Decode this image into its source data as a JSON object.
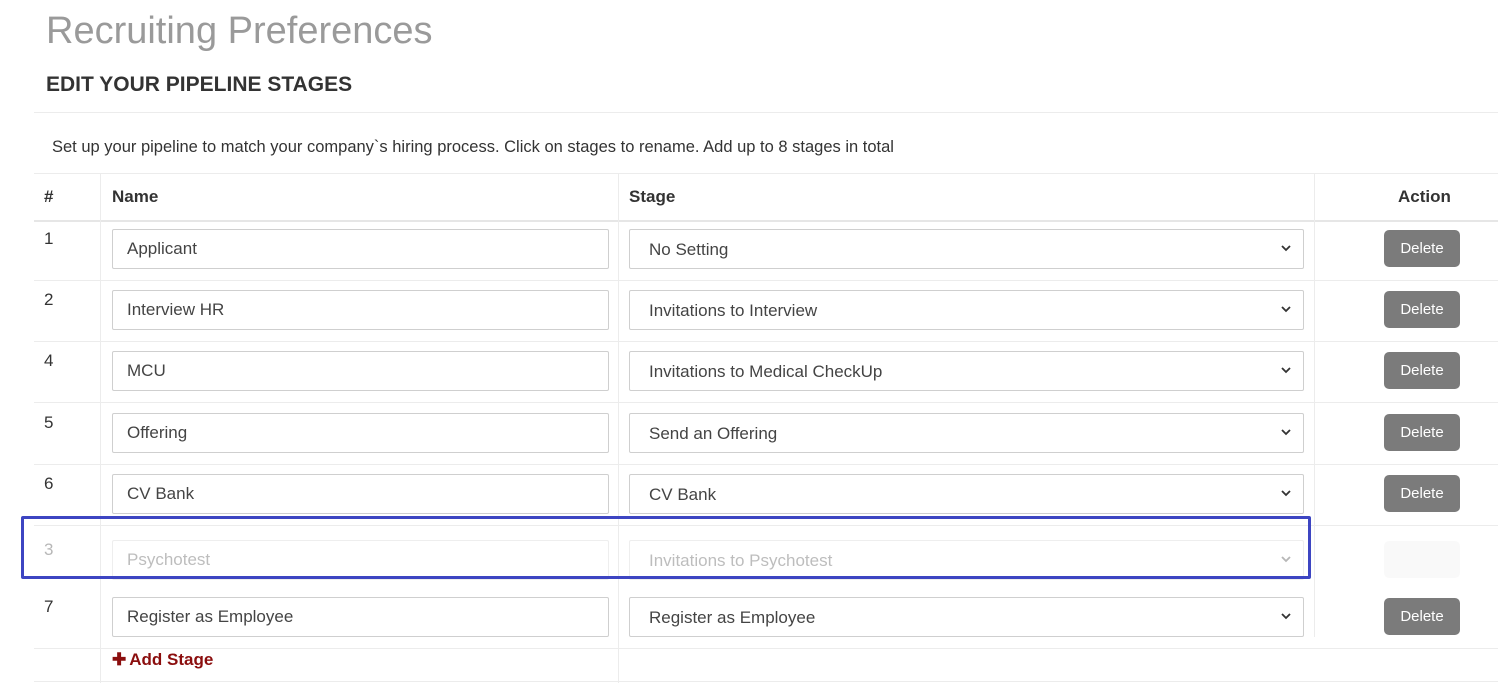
{
  "page": {
    "title": "Recruiting Preferences",
    "section_title": "EDIT YOUR PIPELINE STAGES",
    "intro": "Set up your pipeline to match your company`s hiring process. Click on stages to rename. Add up to 8 stages in total"
  },
  "table": {
    "headers": {
      "num": "#",
      "name": "Name",
      "stage": "Stage",
      "action": "Action"
    },
    "delete_label": "Delete",
    "rows": [
      {
        "num": "1",
        "name": "Applicant",
        "stage": "No Setting"
      },
      {
        "num": "2",
        "name": "Interview HR",
        "stage": "Invitations to Interview"
      },
      {
        "num": "4",
        "name": "MCU",
        "stage": "Invitations to Medical CheckUp"
      },
      {
        "num": "5",
        "name": "Offering",
        "stage": "Send an Offering"
      },
      {
        "num": "6",
        "name": "CV Bank",
        "stage": "CV Bank"
      },
      {
        "num": "3",
        "name": "Psychotest",
        "stage": "Invitations to Psychotest",
        "dragging": true
      },
      {
        "num": "7",
        "name": "Register as Employee",
        "stage": "Register as Employee"
      }
    ],
    "add_stage_label": "Add Stage"
  },
  "colors": {
    "highlight": "#3d45c2",
    "add_link": "#8b0e0e",
    "delete_button": "#7b7b7b"
  }
}
